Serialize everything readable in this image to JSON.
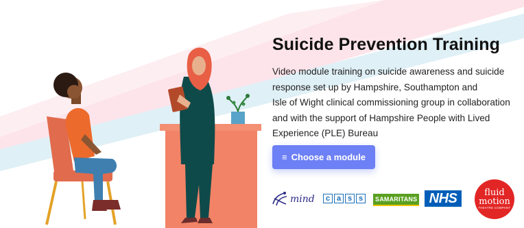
{
  "hero": {
    "title": "Suicide Prevention Training",
    "description_lines": [
      "Video module training on suicide awareness and suicide",
      "response set up by Hampshire, Southampton and",
      "Isle of Wight clinical commissioning group in collaboration",
      "and with the support of Hampshire People with Lived",
      "Experience (PLE) Bureau"
    ],
    "cta": {
      "icon": "menu-icon",
      "glyph": "≡",
      "label": "Choose a module"
    }
  },
  "partners": {
    "mind": {
      "text": "mind"
    },
    "cass": {
      "letters": [
        "c",
        "a",
        "s",
        "s"
      ]
    },
    "samaritans": {
      "text": "SAMARITANS"
    },
    "nhs": {
      "text": "NHS"
    },
    "fluid_motion": {
      "line1": "fluid",
      "line2": "motion",
      "line3": "THEATRE COMPANY"
    }
  },
  "colors": {
    "accent": "#6e80f5",
    "stripe_pink": "#fde4ea",
    "stripe_blue": "#dff0f6",
    "desk": "#f28366",
    "nhs_blue": "#005eb8",
    "fluid_red": "#e22625"
  }
}
